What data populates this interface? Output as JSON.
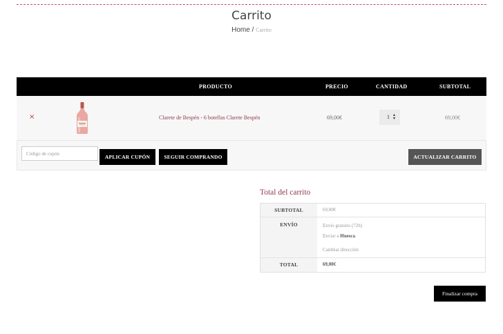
{
  "header": {
    "title": "Carrito",
    "breadcrumb": {
      "home": "Home",
      "separator": " / ",
      "current": "Carrito"
    }
  },
  "cart": {
    "columns": {
      "product": "PRODUCTO",
      "price": "PRECIO",
      "quantity": "CANTIDAD",
      "subtotal": "SUBTOTAL"
    },
    "items": [
      {
        "remove": "×",
        "image": "rose-wine-bottle",
        "name": "Clarete de Bespén - 6 botellas Clarete Bespén",
        "price": "69,00€",
        "quantity": "1",
        "subtotal": "69,00€"
      }
    ],
    "actions": {
      "coupon_placeholder": "Código de cupón",
      "apply_coupon": "APLICAR CUPÓN",
      "continue_shopping": "SEGUIR COMPRANDO",
      "update_cart": "ACTUALIZAR CARRITO"
    }
  },
  "totals": {
    "title": "Total del carrito",
    "subtotal_label": "SUBTOTAL",
    "subtotal_value": "69,00€",
    "shipping_label": "ENVÍO",
    "shipping_method": "Envío gratuito (72h)",
    "ship_to_prefix": "Enviar a ",
    "ship_to_place": "Huesca",
    "ship_to_suffix": ".",
    "change_address": "Cambiar dirección",
    "total_label": "TOTAL",
    "total_value": "69,00€"
  },
  "checkout": {
    "label": "Finalizar compra"
  },
  "colors": {
    "accent": "#8e3a4b",
    "remove": "#c0392b",
    "header_bg": "#000000",
    "rule": "#c9436b"
  }
}
